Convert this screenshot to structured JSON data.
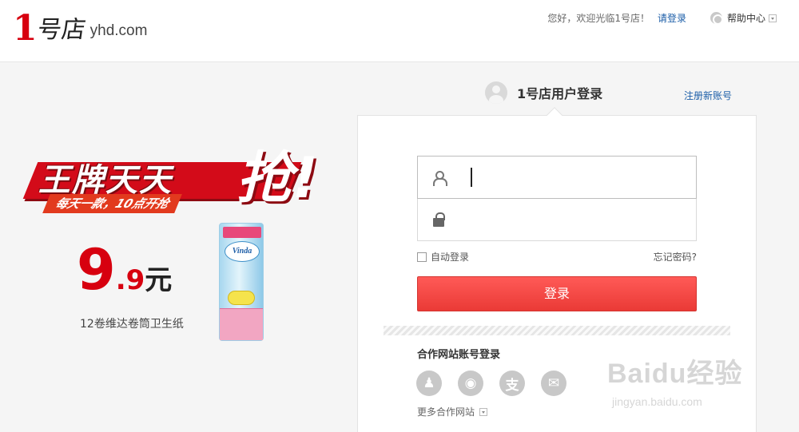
{
  "header": {
    "logo_mark": "1",
    "logo_cn": "号店",
    "logo_domain": "yhd.com",
    "greeting": "您好，欢迎光临1号店！",
    "login_link": "请登录",
    "help": "帮助中心"
  },
  "promo": {
    "title": "王牌天天",
    "title_big": "抢!",
    "subtitle": "每天一款，10点开抢",
    "price_int": "9",
    "price_dec": ".9",
    "price_unit": "元",
    "description": "12卷维达卷筒卫生纸",
    "product_brand": "Vinda"
  },
  "login": {
    "title": "1号店用户登录",
    "register": "注册新账号",
    "username_value": "",
    "password_value": "",
    "auto_login": "自动登录",
    "forgot": "忘记密码?",
    "submit": "登录",
    "partner_title": "合作网站账号登录",
    "partners": [
      {
        "icon": "qq-icon",
        "glyph": "♟"
      },
      {
        "icon": "weibo-icon",
        "glyph": "◉"
      },
      {
        "icon": "alipay-icon",
        "glyph": "支"
      },
      {
        "icon": "wechat-icon",
        "glyph": "✉"
      }
    ],
    "more_partners": "更多合作网站"
  },
  "watermark": {
    "main": "Baidu经验",
    "sub": "jingyan.baidu.com"
  },
  "colors": {
    "brand_red": "#d7000f",
    "button_red": "#ea3a36",
    "link_blue": "#1c5ea8"
  }
}
